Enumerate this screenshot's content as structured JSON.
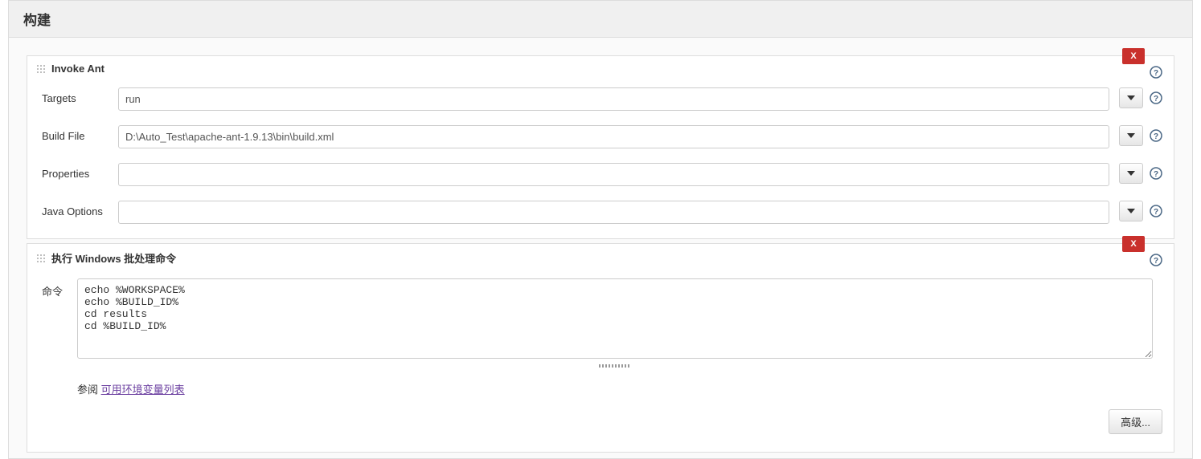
{
  "section": {
    "title": "构建"
  },
  "steps": {
    "invokeAnt": {
      "title": "Invoke Ant",
      "fields": {
        "targets": {
          "label": "Targets",
          "value": "run"
        },
        "buildFile": {
          "label": "Build File",
          "value": "D:\\Auto_Test\\apache-ant-1.9.13\\bin\\build.xml"
        },
        "properties": {
          "label": "Properties",
          "value": ""
        },
        "javaOptions": {
          "label": "Java Options",
          "value": ""
        }
      }
    },
    "windowsBatch": {
      "title": "执行 Windows 批处理命令",
      "cmdLabel": "命令",
      "cmdValue": "echo %WORKSPACE%\necho %BUILD_ID%\ncd results\ncd %BUILD_ID%",
      "referencePrefix": "参阅 ",
      "referenceLink": "可用环境变量列表",
      "advancedButton": "高级..."
    }
  },
  "icons": {
    "delete": "X"
  }
}
